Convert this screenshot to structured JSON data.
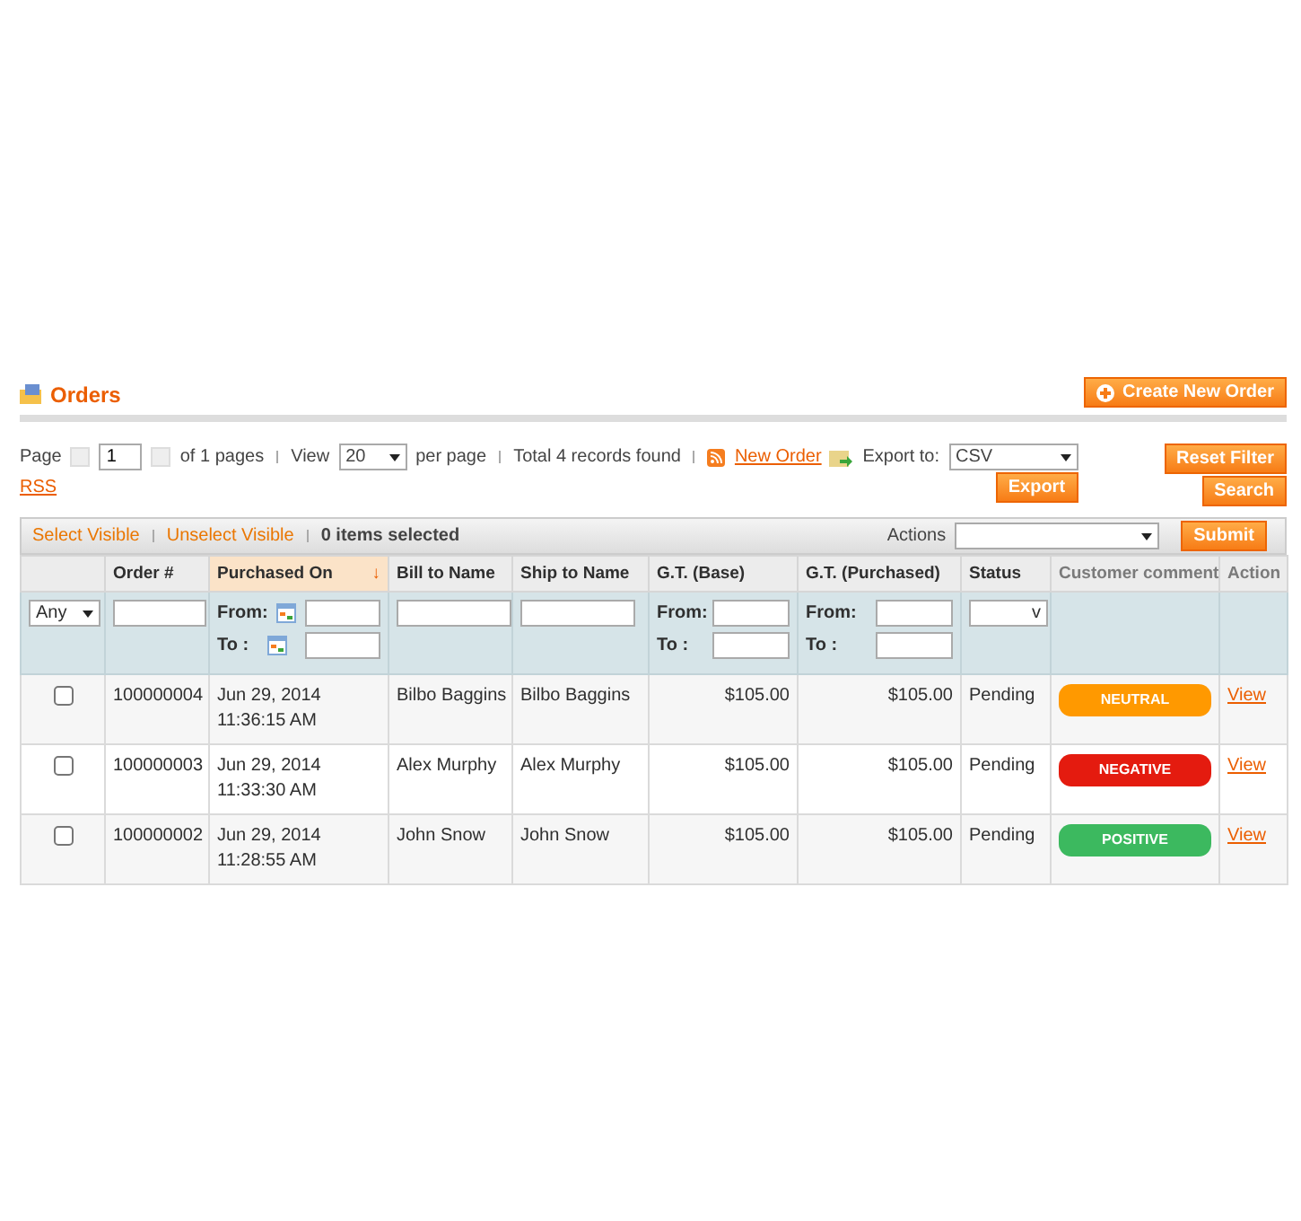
{
  "header": {
    "title": "Orders",
    "create_button": "Create New Order"
  },
  "pager": {
    "page_label": "Page",
    "page_value": "1",
    "of_pages": "of 1 pages",
    "view_label": "View",
    "view_value": "20",
    "per_page": "per page",
    "total": "Total 4 records found",
    "new_order_link": "New Order",
    "rss_link": "RSS"
  },
  "export": {
    "label": "Export to:",
    "format": "CSV",
    "button": "Export"
  },
  "filter_buttons": [
    "Reset Filter",
    "Search"
  ],
  "massaction": {
    "select_visible": "Select Visible",
    "unselect_visible": "Unselect Visible",
    "selected_count": "0 items selected",
    "actions_label": "Actions",
    "submit": "Submit"
  },
  "columns": [
    {
      "sorted": false,
      "kind": "any",
      "any_value": "Any"
    },
    {
      "label": "Order #",
      "sorted": false,
      "kind": "text"
    },
    {
      "label": "Purchased On",
      "sorted": true,
      "sort_indicator": "↓",
      "kind": "date",
      "from_label": "From:",
      "to_label": "To :"
    },
    {
      "label": "Bill to Name",
      "sorted": false,
      "kind": "text"
    },
    {
      "label": "Ship to Name",
      "sorted": false,
      "kind": "text"
    },
    {
      "label": "G.T. (Base)",
      "sorted": false,
      "kind": "range",
      "from_label": "From:",
      "to_label": "To :"
    },
    {
      "label": "G.T. (Purchased)",
      "sorted": false,
      "kind": "range",
      "from_label": "From:",
      "to_label": "To :"
    },
    {
      "label": "Status",
      "sorted": false,
      "kind": "select",
      "select_caret": "v"
    },
    {
      "label": "Customer comment",
      "sorted": false,
      "kind": "none",
      "muted": true
    },
    {
      "label": "Action",
      "sorted": false,
      "kind": "none",
      "muted": true
    }
  ],
  "rows": [
    {
      "checked": false,
      "order": "100000004",
      "date": "Jun 29, 2014",
      "time": "11:36:15 AM",
      "bill": "Bilbo Baggins",
      "ship": "Bilbo Baggins",
      "base": "$105.00",
      "purchased": "$105.00",
      "status": "Pending",
      "comment": "NEUTRAL",
      "color": "#ff9900",
      "action": "View"
    },
    {
      "checked": false,
      "order": "100000003",
      "date": "Jun 29, 2014",
      "time": "11:33:30 AM",
      "bill": "Alex Murphy",
      "ship": "Alex Murphy",
      "base": "$105.00",
      "purchased": "$105.00",
      "status": "Pending",
      "comment": "NEGATIVE",
      "color": "#e41b0f",
      "action": "View"
    },
    {
      "checked": false,
      "order": "100000002",
      "date": "Jun 29, 2014",
      "time": "11:28:55 AM",
      "bill": "John Snow",
      "ship": "John Snow",
      "base": "$105.00",
      "purchased": "$105.00",
      "status": "Pending",
      "comment": "POSITIVE",
      "color": "#3cb95f",
      "action": "View"
    }
  ]
}
